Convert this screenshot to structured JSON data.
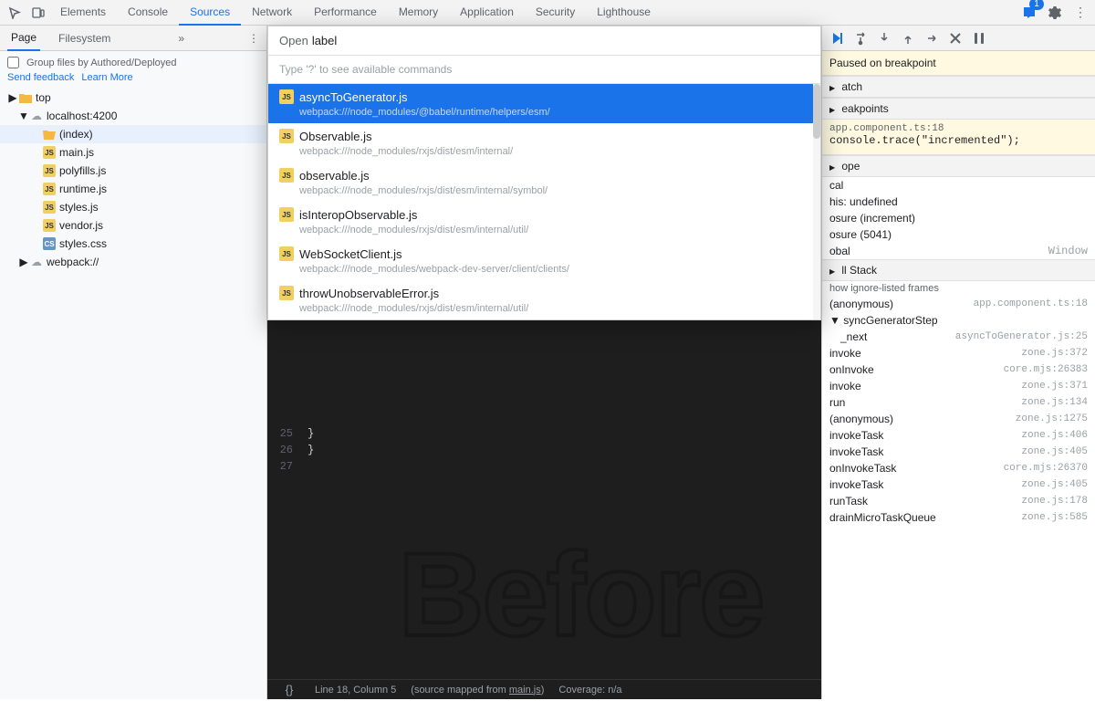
{
  "toolbar": {
    "tabs": [
      "Elements",
      "Console",
      "Sources",
      "Network",
      "Performance",
      "Memory",
      "Application",
      "Security",
      "Lighthouse"
    ],
    "active_tab": "Sources",
    "icons": [
      "cursor",
      "device",
      "dots"
    ],
    "badge_count": "1",
    "right_icons": [
      "chat-bubble",
      "gear",
      "vertical-dots"
    ]
  },
  "left_panel": {
    "tabs": [
      "Page",
      "Filesystem"
    ],
    "active_tab": "Page",
    "group_label": "Group files by Authored/Deployed",
    "feedback_link": "Send feedback",
    "learn_link": "Learn More",
    "tree": [
      {
        "level": 0,
        "type": "folder-closed",
        "label": "top",
        "arrow": "▶"
      },
      {
        "level": 1,
        "type": "cloud",
        "label": "localhost:4200",
        "arrow": "▼"
      },
      {
        "level": 2,
        "type": "folder-open",
        "label": "(index)",
        "arrow": "",
        "selected": true
      },
      {
        "level": 2,
        "type": "js",
        "label": "main.js",
        "arrow": ""
      },
      {
        "level": 2,
        "type": "js",
        "label": "polyfills.js",
        "arrow": ""
      },
      {
        "level": 2,
        "type": "js",
        "label": "runtime.js",
        "arrow": ""
      },
      {
        "level": 2,
        "type": "js",
        "label": "styles.js",
        "arrow": ""
      },
      {
        "level": 2,
        "type": "js",
        "label": "vendor.js",
        "arrow": ""
      },
      {
        "level": 2,
        "type": "css",
        "label": "styles.css",
        "arrow": ""
      },
      {
        "level": 1,
        "type": "cloud",
        "label": "webpack://",
        "arrow": "▶"
      }
    ]
  },
  "quick_open": {
    "label": "Open",
    "input_value": "label",
    "hint": "Type '?' to see available commands",
    "results": [
      {
        "name": "asyncToGenerator.js",
        "path_prefix": "webpack:///node_modules/@babel/runtime/helpers/esm/",
        "path_highlight": "",
        "selected": true
      },
      {
        "name": "Observable.js",
        "path_prefix": "webpack:///node_modules/rxjs/dist/esm/intern",
        "path_highlight": "al",
        "path_suffix": "/",
        "selected": false
      },
      {
        "name": "observable.js",
        "path_prefix": "webpack:///node_modules/rxjs/dist/esm/intern",
        "path_highlight": "al",
        "path_suffix": "/symbol/",
        "selected": false
      },
      {
        "name": "isInteropObservable.js",
        "path_prefix": "webpack:///node_modules/rxjs/dist/esm/intern",
        "path_highlight": "al",
        "path_suffix": "/util/",
        "selected": false
      },
      {
        "name": "WebSocketClient.js",
        "path_prefix": "webpack:///node_modules/webpack-dev-server/client/clients/",
        "path_highlight": "",
        "path_suffix": "",
        "selected": false
      },
      {
        "name": "throwUnobservableError.js",
        "path_prefix": "webpack:///node_modules/rxjs/dist/esm/intern",
        "path_highlight": "al",
        "path_suffix": "/util/",
        "selected": false
      }
    ]
  },
  "code": {
    "lines": [
      {
        "num": "25",
        "content": "  }"
      },
      {
        "num": "26",
        "content": "}"
      },
      {
        "num": "27",
        "content": ""
      }
    ],
    "big_text": "Before",
    "status": "Line 18, Column 5",
    "source_map": "(source mapped from main.js)",
    "coverage": "Coverage: n/a",
    "format_button": "{}"
  },
  "right_panel": {
    "debug_icons": [
      "resume",
      "step-over",
      "step-into",
      "step-out",
      "step",
      "deactivate",
      "pause"
    ],
    "paused_label": "Paused on breakpoint",
    "sections": {
      "watch": "atch",
      "breakpoints": "eakpoints"
    },
    "breakpoint": {
      "file": "app.component.ts:18",
      "code": "console.trace(\"incremented\");"
    },
    "scope": {
      "label": "ope",
      "items": [
        {
          "name": "cal",
          "value": ""
        },
        {
          "name": "his: undefined",
          "value": ""
        },
        {
          "name": "osure (increment)",
          "value": ""
        },
        {
          "name": "osure (5041)",
          "value": ""
        },
        {
          "name": "obal",
          "value": "Window"
        }
      ]
    },
    "call_stack": {
      "label": "ll Stack",
      "show_ignored": "how ignore-listed frames",
      "items": [
        {
          "name": "(anonymous)",
          "loc": "app.component.ts:18"
        },
        {
          "name": "▼ syncGeneratorStep",
          "loc": ""
        },
        {
          "name": "_next",
          "loc": "asyncToGenerator.js:25"
        },
        {
          "name": "invoke",
          "loc": "zone.js:372"
        },
        {
          "name": "onInvoke",
          "loc": "core.mjs:26383"
        },
        {
          "name": "invoke",
          "loc": "zone.js:371"
        },
        {
          "name": "run",
          "loc": "zone.js:134"
        },
        {
          "name": "(anonymous)",
          "loc": "zone.js:1275"
        },
        {
          "name": "invokeTask",
          "loc": "zone.js:406"
        },
        {
          "name": "invokeTask",
          "loc": "zone.js:405"
        },
        {
          "name": "onInvokeTask",
          "loc": "core.mjs:26370"
        },
        {
          "name": "invokeTask",
          "loc": "zone.js:405"
        },
        {
          "name": "runTask",
          "loc": "zone.js:178"
        },
        {
          "name": "drainMicroTaskQueue",
          "loc": "zone.js:585"
        }
      ]
    }
  }
}
